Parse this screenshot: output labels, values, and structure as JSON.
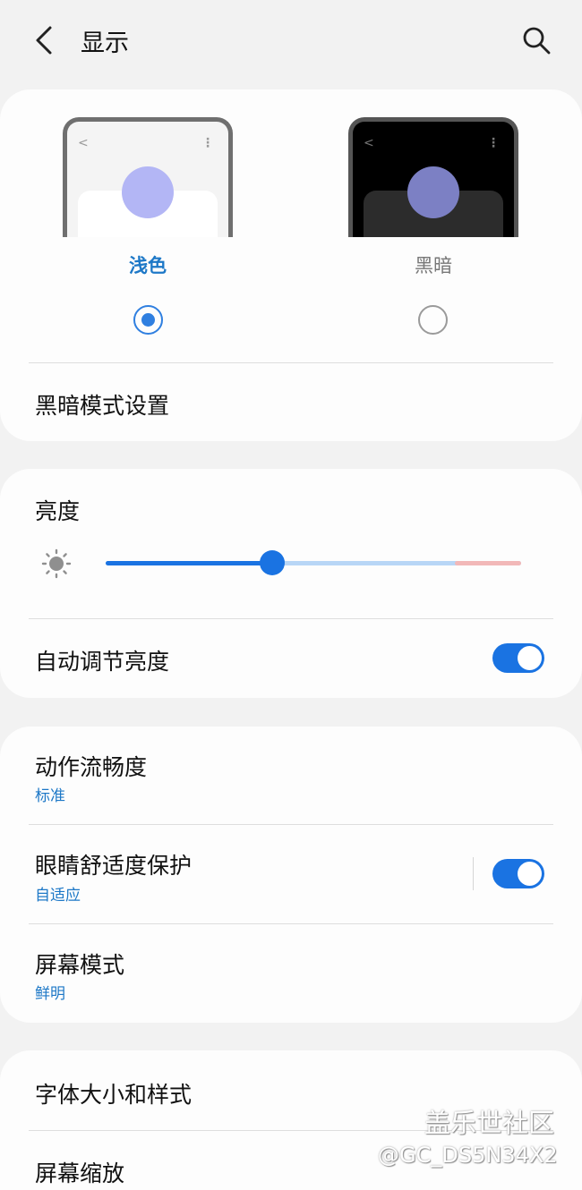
{
  "header": {
    "title": "显示"
  },
  "theme": {
    "light_label": "浅色",
    "dark_label": "黑暗",
    "selected": "light",
    "dark_settings_label": "黑暗模式设置"
  },
  "brightness": {
    "title": "亮度",
    "level_percent": 40,
    "auto_label": "自动调节亮度",
    "auto_on": true
  },
  "motion": {
    "title": "动作流畅度",
    "value": "标准"
  },
  "eye_comfort": {
    "title": "眼睛舒适度保护",
    "value": "自适应",
    "on": true
  },
  "screen_mode": {
    "title": "屏幕模式",
    "value": "鲜明"
  },
  "font": {
    "title": "字体大小和样式"
  },
  "zoom": {
    "title": "屏幕缩放"
  },
  "watermark": {
    "line1": "盖乐世社区",
    "line2": "@GC_DS5N34X2"
  },
  "colors": {
    "accent": "#1a73e2",
    "subtext": "#1d78c7",
    "track_light": "#b8d6f6",
    "track_hot": "#f2b8b8"
  }
}
